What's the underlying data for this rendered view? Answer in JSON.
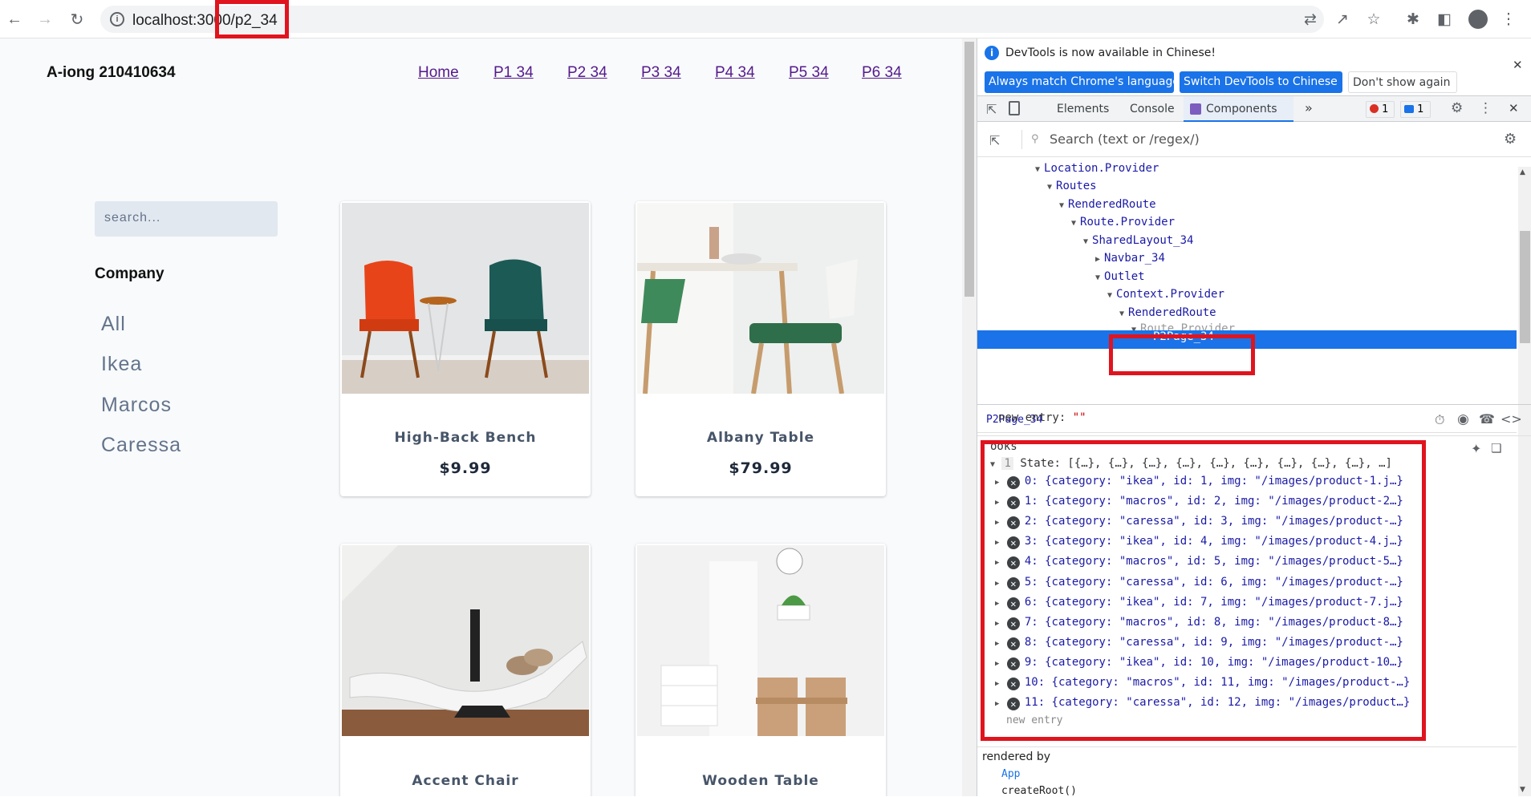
{
  "browser": {
    "url": "localhost:3000/p2_34",
    "icons": [
      "back-arrow-icon",
      "forward-arrow-icon",
      "reload-icon",
      "info-icon",
      "translate-icon",
      "share-icon",
      "star-icon",
      "extensions-icon",
      "side-panel-icon",
      "profile-icon",
      "more-vert-icon"
    ]
  },
  "page": {
    "brand": "A-iong 210410634",
    "nav": [
      "Home",
      "P1 34",
      "P2 34",
      "P3 34",
      "P4 34",
      "P5 34",
      "P6 34"
    ],
    "search_placeholder": "search...",
    "company_heading": "Company",
    "categories": [
      "All",
      "Ikea",
      "Marcos",
      "Caressa"
    ],
    "products": [
      {
        "title": "High-Back Bench",
        "price": "$9.99"
      },
      {
        "title": "Albany Table",
        "price": "$79.99"
      },
      {
        "title": "Accent Chair",
        "price": ""
      },
      {
        "title": "Wooden Table",
        "price": ""
      }
    ]
  },
  "devtools": {
    "infobar": {
      "message": "DevTools is now available in Chinese!",
      "btn_match": "Always match Chrome's language",
      "btn_switch": "Switch DevTools to Chinese",
      "btn_dismiss": "Don't show again"
    },
    "tabs": {
      "elements": "Elements",
      "console": "Console",
      "components": "Components",
      "more": "»",
      "errors": "1",
      "messages": "1"
    },
    "search_placeholder": "Search (text or /regex/)",
    "tree": [
      "Location.Provider",
      "Routes",
      "RenderedRoute",
      "Route.Provider",
      "SharedLayout_34",
      "Navbar_34",
      "Outlet",
      "Context.Provider",
      "RenderedRoute",
      "Route.Provider"
    ],
    "selected": "P2Page_34",
    "side_title": "P2Page_34",
    "new_entry_label": "new entry:",
    "new_entry_value": "\"\"",
    "hooks_label": "ooks",
    "hook_index": "1",
    "state_summary": "State: [{…}, {…}, {…}, {…}, {…}, {…}, {…}, {…}, {…}, …]",
    "state_items": [
      "0: {category: \"ikea\", id: 1, img: \"/images/product-1.j…}",
      "1: {category: \"macros\", id: 2, img: \"/images/product-2…}",
      "2: {category: \"caressa\", id: 3, img: \"/images/product-…}",
      "3: {category: \"ikea\", id: 4, img: \"/images/product-4.j…}",
      "4: {category: \"macros\", id: 5, img: \"/images/product-5…}",
      "5: {category: \"caressa\", id: 6, img: \"/images/product-…}",
      "6: {category: \"ikea\", id: 7, img: \"/images/product-7.j…}",
      "7: {category: \"macros\", id: 8, img: \"/images/product-8…}",
      "8: {category: \"caressa\", id: 9, img: \"/images/product-…}",
      "9: {category: \"ikea\", id: 10, img: \"/images/product-10…}",
      "10: {category: \"macros\", id: 11, img: \"/images/product-…}",
      "11: {category: \"caressa\", id: 12, img: \"/images/product…}"
    ],
    "new_entry_bottom": "new entry",
    "rendered_by": "rendered by",
    "rendered_by_items": [
      "App",
      "createRoot()"
    ]
  },
  "colors": {
    "annotation_red": "#e0141e",
    "selection_blue": "#1a73e8",
    "link_purple": "#551a8b"
  }
}
